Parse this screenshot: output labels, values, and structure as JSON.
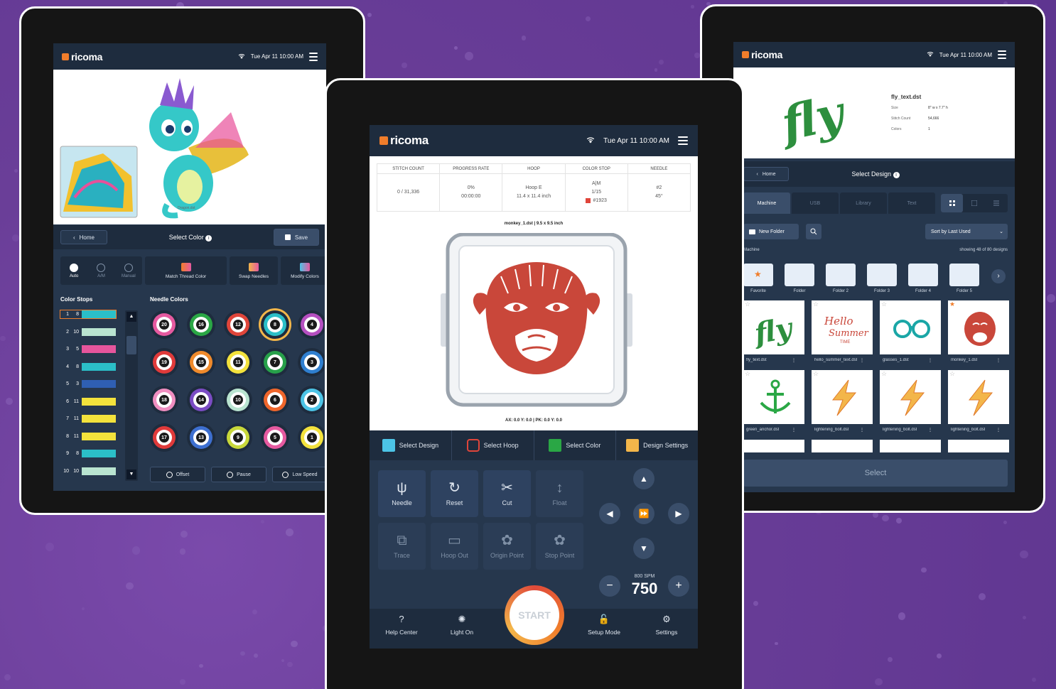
{
  "brand": "ricoma",
  "status": {
    "date_time": "Tue Apr 11  10:00 AM",
    "icons": [
      "wifi-icon",
      "menu-icon"
    ]
  },
  "left": {
    "preview_file": "Dragon.dst",
    "nav": {
      "home": "Home",
      "title": "Select Color",
      "save": "Save"
    },
    "modes": [
      {
        "label": "Auto",
        "icon": "auto-icon"
      },
      {
        "label": "A/M",
        "icon": "am-icon"
      },
      {
        "label": "Manual",
        "icon": "manual-icon"
      }
    ],
    "tools": [
      {
        "label": "Match Thread Color",
        "icon": "match-color-icon"
      },
      {
        "label": "Swap Needles",
        "icon": "swap-needles-icon"
      },
      {
        "label": "Modify Colors",
        "icon": "modify-colors-icon"
      }
    ],
    "color_stops_title": "Color Stops",
    "needle_colors_title": "Needle Colors",
    "color_stops": [
      {
        "n": "1",
        "needle": "8",
        "color": "#2bbfc8"
      },
      {
        "n": "2",
        "needle": "10",
        "color": "#b9e4d0"
      },
      {
        "n": "3",
        "needle": "5",
        "color": "#e6559c"
      },
      {
        "n": "4",
        "needle": "8",
        "color": "#2bbfc8"
      },
      {
        "n": "5",
        "needle": "3",
        "color": "#2f5fb3"
      },
      {
        "n": "6",
        "needle": "11",
        "color": "#f3e23c"
      },
      {
        "n": "7",
        "needle": "11",
        "color": "#f3e23c"
      },
      {
        "n": "8",
        "needle": "11",
        "color": "#f3e23c"
      },
      {
        "n": "9",
        "needle": "8",
        "color": "#2bbfc8"
      },
      {
        "n": "10",
        "needle": "10",
        "color": "#b9e4d0"
      }
    ],
    "needles": [
      {
        "n": "20",
        "color": "#e65aa0"
      },
      {
        "n": "16",
        "color": "#2aa745"
      },
      {
        "n": "12",
        "color": "#e0453a"
      },
      {
        "n": "8",
        "color": "#2bbfc8"
      },
      {
        "n": "4",
        "color": "#b54fc0"
      },
      {
        "n": "19",
        "color": "#e03a3a"
      },
      {
        "n": "15",
        "color": "#f08a2b"
      },
      {
        "n": "11",
        "color": "#f3e23c"
      },
      {
        "n": "7",
        "color": "#27a04a"
      },
      {
        "n": "3",
        "color": "#2f7fd0"
      },
      {
        "n": "18",
        "color": "#f08ec0"
      },
      {
        "n": "14",
        "color": "#7b4cc4"
      },
      {
        "n": "10",
        "color": "#b9e4d0"
      },
      {
        "n": "6",
        "color": "#f0662b"
      },
      {
        "n": "2",
        "color": "#4cc4e6"
      },
      {
        "n": "17",
        "color": "#e03a3a"
      },
      {
        "n": "13",
        "color": "#3d6fd0"
      },
      {
        "n": "9",
        "color": "#c8d83a"
      },
      {
        "n": "5",
        "color": "#e65aa0"
      },
      {
        "n": "1",
        "color": "#f3e23c"
      }
    ],
    "bottom": [
      {
        "label": "Offset",
        "icon": "offset-icon"
      },
      {
        "label": "Pause",
        "icon": "pause-icon"
      },
      {
        "label": "Low Speed",
        "icon": "low-speed-icon"
      }
    ]
  },
  "center": {
    "stats": [
      {
        "head": "STITCH COUNT",
        "lines": [
          "0 / 31,336"
        ]
      },
      {
        "head": "PROGRESS RATE",
        "lines": [
          "0%",
          "00:00:00"
        ]
      },
      {
        "head": "HOOP",
        "lines": [
          "Hoop E",
          "11.4 x 11.4 inch"
        ]
      },
      {
        "head": "COLOR STOP",
        "lines": [
          "A|M",
          "1/15",
          "#1923"
        ]
      },
      {
        "head": "NEEDLE",
        "lines": [
          "#2",
          "45°"
        ]
      }
    ],
    "stop_color": "#e0453a",
    "design_line": "monkey_1.dst  |  9.5 x 9.5 inch",
    "coords_line": "AX: 0.0  Y: 0.0   |   PK: 0.0  Y: 0.0",
    "tabs": [
      {
        "label": "Select Design",
        "icon": "select-design-icon"
      },
      {
        "label": "Select Hoop",
        "icon": "select-hoop-icon"
      },
      {
        "label": "Select Color",
        "icon": "select-color-icon"
      },
      {
        "label": "Design Settings",
        "icon": "design-settings-icon"
      }
    ],
    "controls": [
      {
        "label": "Needle",
        "icon": "needle-icon",
        "dim": false
      },
      {
        "label": "Reset",
        "icon": "reset-icon",
        "dim": false
      },
      {
        "label": "Cut",
        "icon": "cut-icon",
        "dim": false
      },
      {
        "label": "Float",
        "icon": "float-icon",
        "dim": true
      },
      {
        "label": "Trace",
        "icon": "trace-icon",
        "dim": true
      },
      {
        "label": "Hoop Out",
        "icon": "hoop-out-icon",
        "dim": true
      },
      {
        "label": "Origin Point",
        "icon": "origin-point-icon",
        "dim": true
      },
      {
        "label": "Stop Point",
        "icon": "stop-point-icon",
        "dim": true
      }
    ],
    "speed_max": "800 SPM",
    "speed": "750",
    "start": "START",
    "bottom_nav": [
      {
        "label": "Help Center",
        "icon": "help-icon"
      },
      {
        "label": "Light On",
        "icon": "light-icon"
      },
      {
        "label": "Setup Mode",
        "icon": "unlock-icon"
      },
      {
        "label": "Settings",
        "icon": "gear-icon"
      }
    ]
  },
  "right": {
    "file": {
      "name": "fly_text.dst",
      "rows": [
        [
          "Size",
          "8\" w x 7.7\" h"
        ],
        [
          "Stitch Count",
          "54,666"
        ],
        [
          "Colors",
          "1"
        ]
      ]
    },
    "preview_text": "fly",
    "nav": {
      "home": "Home",
      "title": "Select Design"
    },
    "tabs": [
      "Machine",
      "USB",
      "Library",
      "Text"
    ],
    "new_folder": "New Folder",
    "sort": "Sort by   Last Used",
    "location": "Machine",
    "showing": "showing 48 of 80 designs",
    "folders": [
      "Favorite",
      "Folder",
      "Folder 2",
      "Folder 3",
      "Folder 4",
      "Folder 5"
    ],
    "designs": [
      {
        "name": "fly_text.dst",
        "kind": "fly"
      },
      {
        "name": "hello_summer_text.dst",
        "kind": "hello"
      },
      {
        "name": "glasses_1.dst",
        "kind": "glasses"
      },
      {
        "name": "monkey_1.dst",
        "kind": "monkey"
      },
      {
        "name": "green_anchor.dst",
        "kind": "anchor"
      },
      {
        "name": "lightening_bolt.dst",
        "kind": "bolt"
      },
      {
        "name": "lightening_bolt.dst",
        "kind": "bolt"
      },
      {
        "name": "lightening_bolt.dst",
        "kind": "bolt"
      }
    ],
    "hello_text": [
      "Hello",
      "Summer",
      "TIME"
    ],
    "select": "Select"
  }
}
